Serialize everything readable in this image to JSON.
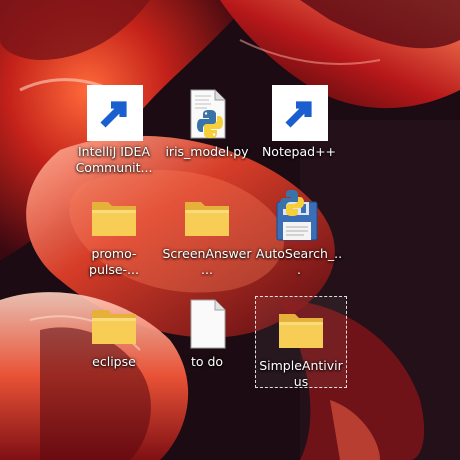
{
  "desktop": {
    "icons": [
      {
        "label": "IntelliJ IDEA Communit...",
        "icon": "intellij-icon",
        "shortcut": true
      },
      {
        "label": "iris_model.py",
        "icon": "python-file-icon",
        "shortcut": false
      },
      {
        "label": "Notepad++",
        "icon": "notepadpp-icon",
        "shortcut": true
      },
      {
        "label": "promo-pulse-...",
        "icon": "folder-icon",
        "shortcut": false
      },
      {
        "label": "ScreenAnswer...",
        "icon": "folder-icon",
        "shortcut": false
      },
      {
        "label": "AutoSearch_...",
        "icon": "python-save-icon",
        "shortcut": false
      },
      {
        "label": "eclipse",
        "icon": "folder-icon",
        "shortcut": false
      },
      {
        "label": "to do",
        "icon": "blank-file-icon",
        "shortcut": false
      },
      {
        "label": "SimpleAntivirus",
        "icon": "folder-icon",
        "shortcut": false,
        "selected": true
      }
    ]
  },
  "colors": {
    "folder_body": "#f5c84a",
    "folder_tab": "#e8b53a",
    "wallpaper_red": "#c4221a",
    "wallpaper_dark": "#1a0a10",
    "intellij_bg": "#000000"
  }
}
